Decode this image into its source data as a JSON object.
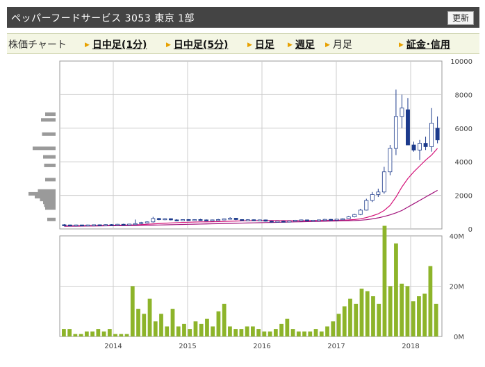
{
  "header": {
    "title": "ペッパーフードサービス 3053 東京 1部",
    "refresh_label": "更新"
  },
  "nav": {
    "label": "株価チャート",
    "items": [
      "日中足(1分)",
      "日中足(5分)",
      "日足",
      "週足",
      "月足",
      "証金･信用"
    ],
    "current": "月足"
  },
  "colors": {
    "up": "#ffffff",
    "down": "#1c3a8c",
    "ma_short": "#d4147a",
    "ma_long": "#a0107a",
    "volume": "#8db42a",
    "profile": "#9a9a9a",
    "grid": "#cccccc"
  },
  "chart_data": {
    "type": "candlestick",
    "price_ticks": [
      "10000",
      "8000",
      "6000",
      "4000",
      "2000",
      "0"
    ],
    "volume_ticks": [
      "40M",
      "20M",
      "0M"
    ],
    "ylim": [
      0,
      10000
    ],
    "volume_ylim": [
      0,
      40000000
    ],
    "x_ticks": [
      "2014",
      "2015",
      "2016",
      "2017",
      "2018"
    ],
    "candles": [
      {
        "o": 250,
        "h": 290,
        "l": 220,
        "c": 240
      },
      {
        "o": 240,
        "h": 260,
        "l": 210,
        "c": 230
      },
      {
        "o": 230,
        "h": 260,
        "l": 210,
        "c": 240
      },
      {
        "o": 240,
        "h": 250,
        "l": 210,
        "c": 220
      },
      {
        "o": 220,
        "h": 260,
        "l": 210,
        "c": 240
      },
      {
        "o": 240,
        "h": 270,
        "l": 230,
        "c": 250
      },
      {
        "o": 250,
        "h": 270,
        "l": 230,
        "c": 240
      },
      {
        "o": 240,
        "h": 280,
        "l": 230,
        "c": 260
      },
      {
        "o": 260,
        "h": 290,
        "l": 240,
        "c": 250
      },
      {
        "o": 250,
        "h": 300,
        "l": 240,
        "c": 280
      },
      {
        "o": 280,
        "h": 310,
        "l": 250,
        "c": 260
      },
      {
        "o": 260,
        "h": 300,
        "l": 250,
        "c": 290
      },
      {
        "o": 290,
        "h": 560,
        "l": 270,
        "c": 320
      },
      {
        "o": 320,
        "h": 420,
        "l": 280,
        "c": 380
      },
      {
        "o": 380,
        "h": 450,
        "l": 340,
        "c": 420
      },
      {
        "o": 420,
        "h": 720,
        "l": 380,
        "c": 620
      },
      {
        "o": 620,
        "h": 660,
        "l": 520,
        "c": 560
      },
      {
        "o": 560,
        "h": 650,
        "l": 520,
        "c": 610
      },
      {
        "o": 610,
        "h": 630,
        "l": 510,
        "c": 540
      },
      {
        "o": 540,
        "h": 580,
        "l": 460,
        "c": 490
      },
      {
        "o": 490,
        "h": 580,
        "l": 470,
        "c": 560
      },
      {
        "o": 560,
        "h": 580,
        "l": 490,
        "c": 520
      },
      {
        "o": 520,
        "h": 580,
        "l": 500,
        "c": 560
      },
      {
        "o": 560,
        "h": 600,
        "l": 500,
        "c": 540
      },
      {
        "o": 540,
        "h": 570,
        "l": 480,
        "c": 500
      },
      {
        "o": 500,
        "h": 560,
        "l": 480,
        "c": 540
      },
      {
        "o": 540,
        "h": 600,
        "l": 500,
        "c": 560
      },
      {
        "o": 560,
        "h": 620,
        "l": 520,
        "c": 600
      },
      {
        "o": 600,
        "h": 700,
        "l": 560,
        "c": 640
      },
      {
        "o": 640,
        "h": 660,
        "l": 520,
        "c": 560
      },
      {
        "o": 560,
        "h": 580,
        "l": 500,
        "c": 530
      },
      {
        "o": 530,
        "h": 570,
        "l": 500,
        "c": 550
      },
      {
        "o": 550,
        "h": 570,
        "l": 490,
        "c": 510
      },
      {
        "o": 510,
        "h": 560,
        "l": 480,
        "c": 540
      },
      {
        "o": 540,
        "h": 560,
        "l": 440,
        "c": 460
      },
      {
        "o": 460,
        "h": 500,
        "l": 400,
        "c": 420
      },
      {
        "o": 420,
        "h": 480,
        "l": 400,
        "c": 460
      },
      {
        "o": 460,
        "h": 500,
        "l": 420,
        "c": 430
      },
      {
        "o": 430,
        "h": 480,
        "l": 410,
        "c": 470
      },
      {
        "o": 470,
        "h": 540,
        "l": 450,
        "c": 520
      },
      {
        "o": 520,
        "h": 560,
        "l": 490,
        "c": 540
      },
      {
        "o": 540,
        "h": 560,
        "l": 470,
        "c": 500
      },
      {
        "o": 500,
        "h": 540,
        "l": 480,
        "c": 520
      },
      {
        "o": 520,
        "h": 560,
        "l": 500,
        "c": 540
      },
      {
        "o": 540,
        "h": 600,
        "l": 510,
        "c": 570
      },
      {
        "o": 570,
        "h": 600,
        "l": 530,
        "c": 560
      },
      {
        "o": 560,
        "h": 600,
        "l": 540,
        "c": 580
      },
      {
        "o": 580,
        "h": 640,
        "l": 560,
        "c": 610
      },
      {
        "o": 610,
        "h": 760,
        "l": 590,
        "c": 720
      },
      {
        "o": 720,
        "h": 900,
        "l": 690,
        "c": 860
      },
      {
        "o": 860,
        "h": 1200,
        "l": 820,
        "c": 1120
      },
      {
        "o": 1120,
        "h": 1800,
        "l": 1100,
        "c": 1700
      },
      {
        "o": 1700,
        "h": 2200,
        "l": 1600,
        "c": 2050
      },
      {
        "o": 2050,
        "h": 2400,
        "l": 1900,
        "c": 2200
      },
      {
        "o": 2200,
        "h": 3700,
        "l": 2100,
        "c": 3400
      },
      {
        "o": 3400,
        "h": 5000,
        "l": 3200,
        "c": 4800
      },
      {
        "o": 4800,
        "h": 8300,
        "l": 4400,
        "c": 6700
      },
      {
        "o": 6700,
        "h": 8000,
        "l": 6000,
        "c": 7200
      },
      {
        "o": 7100,
        "h": 7800,
        "l": 5000,
        "c": 5000
      },
      {
        "o": 5000,
        "h": 5200,
        "l": 4600,
        "c": 4700
      },
      {
        "o": 4700,
        "h": 5300,
        "l": 4100,
        "c": 5100
      },
      {
        "o": 5100,
        "h": 5500,
        "l": 4700,
        "c": 4900
      },
      {
        "o": 4900,
        "h": 7200,
        "l": 4600,
        "c": 6300
      },
      {
        "o": 6000,
        "h": 6700,
        "l": 5100,
        "c": 5300
      }
    ],
    "ma_short": [
      180,
      185,
      190,
      195,
      200,
      205,
      210,
      215,
      220,
      225,
      230,
      235,
      245,
      260,
      280,
      300,
      320,
      340,
      360,
      375,
      390,
      400,
      410,
      420,
      425,
      430,
      440,
      450,
      460,
      470,
      480,
      490,
      495,
      500,
      500,
      500,
      495,
      495,
      490,
      490,
      495,
      495,
      500,
      505,
      510,
      515,
      520,
      530,
      540,
      560,
      600,
      680,
      780,
      900,
      1100,
      1400,
      1900,
      2500,
      3000,
      3400,
      3750,
      4100,
      4400,
      4800
    ],
    "ma_long": [
      160,
      163,
      166,
      170,
      173,
      176,
      180,
      184,
      188,
      192,
      196,
      200,
      206,
      212,
      220,
      228,
      236,
      244,
      252,
      260,
      268,
      276,
      284,
      292,
      300,
      308,
      316,
      324,
      332,
      340,
      348,
      356,
      364,
      372,
      380,
      388,
      396,
      404,
      412,
      420,
      428,
      436,
      444,
      452,
      460,
      468,
      476,
      484,
      492,
      500,
      520,
      550,
      600,
      660,
      740,
      840,
      960,
      1100,
      1300,
      1500,
      1700,
      1900,
      2100,
      2300
    ],
    "volume_m": [
      3,
      3,
      1,
      1,
      2,
      2,
      3,
      2,
      3,
      1,
      1,
      1,
      20,
      11,
      9,
      15,
      6,
      9,
      4,
      11,
      4,
      5,
      3,
      6,
      5,
      7,
      4,
      10,
      13,
      4,
      3,
      3,
      4,
      4,
      3,
      2,
      2,
      3,
      5,
      7,
      3,
      2,
      2,
      2,
      3,
      2,
      4,
      6,
      9,
      12,
      15,
      13,
      19,
      18,
      16,
      13,
      44,
      20,
      37,
      21,
      20,
      14,
      16,
      17,
      28,
      13
    ],
    "profile": [
      2,
      6,
      7,
      8,
      9,
      10,
      11,
      12,
      16,
      21,
      24,
      27,
      32,
      37,
      39
    ],
    "profile_widths": [
      8,
      10,
      11,
      12,
      15,
      20,
      26,
      17,
      10,
      11,
      12,
      22,
      13,
      14,
      10
    ]
  }
}
